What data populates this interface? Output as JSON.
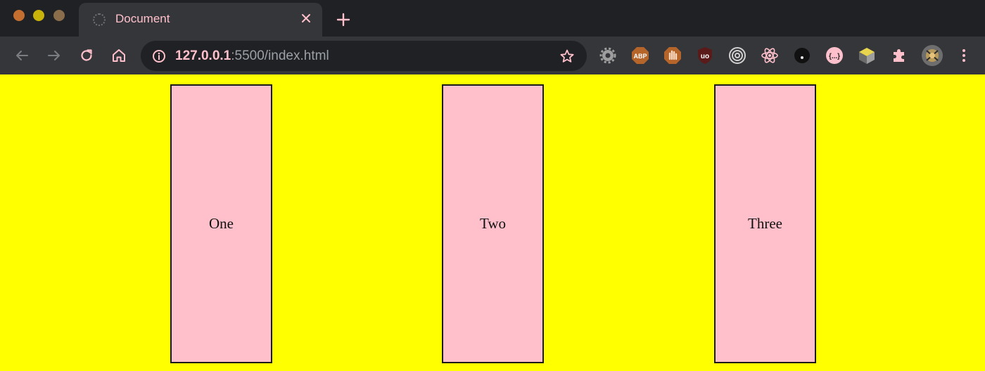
{
  "window": {
    "traffic_lights": [
      "close",
      "minimize",
      "maximize"
    ]
  },
  "tab": {
    "title": "Document",
    "favicon": "loading-globe-icon",
    "close_icon": "close-icon"
  },
  "new_tab_icon": "plus-icon",
  "toolbar": {
    "back_icon": "back-arrow-icon",
    "forward_icon": "forward-arrow-icon",
    "reload_icon": "reload-icon",
    "home_icon": "home-icon",
    "address": {
      "host": "127.0.0.1",
      "rest": ":5500/index.html",
      "info_icon": "info-icon",
      "bookmark_icon": "star-icon"
    },
    "extensions": [
      "gear-extension-icon",
      "adblock-plus-icon",
      "hand-extension-icon",
      "ublock-icon",
      "target-extension-icon",
      "react-devtools-icon",
      "dark-record-extension-icon",
      "json-extension-icon",
      "cube-extension-icon",
      "puzzle-icon"
    ],
    "abp_text": "ABP",
    "ublock_text": "uo",
    "json_text": "{...}",
    "profile_icon": "profile-avatar-icon",
    "menu_icon": "more-vertical-icon"
  },
  "colors": {
    "page_background": "#ffff00",
    "box_background": "#ffc0cb",
    "box_border": "#1b1b1b",
    "tab_text": "#ffc0cb"
  },
  "boxes": [
    {
      "label": "One"
    },
    {
      "label": "Two"
    },
    {
      "label": "Three"
    }
  ]
}
